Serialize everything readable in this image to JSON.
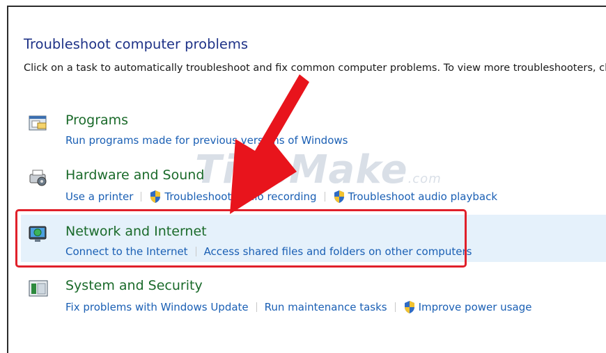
{
  "page": {
    "title": "Troubleshoot computer problems",
    "description": "Click on a task to automatically troubleshoot and fix common computer problems. To view more troubleshooters, clic"
  },
  "categories": [
    {
      "title": "Programs",
      "icon": "programs-icon",
      "links": [
        {
          "label": "Run programs made for previous versions of Windows",
          "shield": false
        }
      ]
    },
    {
      "title": "Hardware and Sound",
      "icon": "hardware-sound-icon",
      "links": [
        {
          "label": "Use a printer",
          "shield": false
        },
        {
          "label": "Troubleshoot audio recording",
          "shield": true
        },
        {
          "label": "Troubleshoot audio playback",
          "shield": true
        }
      ]
    },
    {
      "title": "Network and Internet",
      "icon": "network-internet-icon",
      "links": [
        {
          "label": "Connect to the Internet",
          "shield": false
        },
        {
          "label": "Access shared files and folders on other computers",
          "shield": false
        }
      ]
    },
    {
      "title": "System and Security",
      "icon": "system-security-icon",
      "links": [
        {
          "label": "Fix problems with Windows Update",
          "shield": false
        },
        {
          "label": "Run maintenance tasks",
          "shield": false
        },
        {
          "label": "Improve power usage",
          "shield": true
        }
      ]
    }
  ],
  "watermark": {
    "main": "TipsMake",
    "suffix": ".com"
  },
  "colors": {
    "title": "#1e3287",
    "category": "#1a6a2a",
    "link": "#1a5fb4",
    "highlight": "#e0202a",
    "arrow": "#e8141c",
    "selected_bg": "#e5f1fb"
  }
}
